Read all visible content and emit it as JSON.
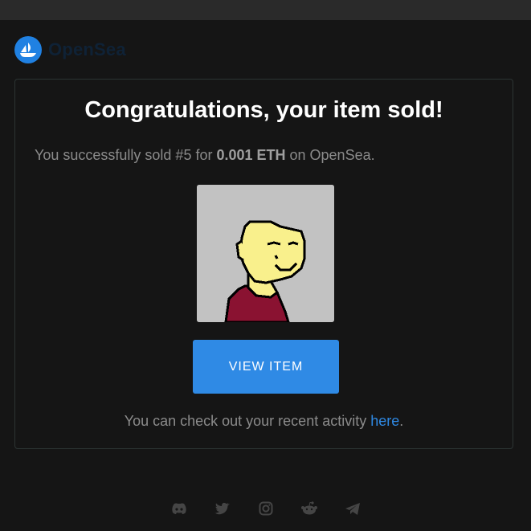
{
  "brand": {
    "name": "OpenSea"
  },
  "email": {
    "title": "Congratulations, your item sold!",
    "message_prefix": "You successfully sold #5 for ",
    "message_amount": "0.001 ETH",
    "message_suffix": " on OpenSea.",
    "view_item_label": "VIEW ITEM",
    "activity_prefix": "You can check out your recent activity ",
    "activity_link": "here",
    "activity_suffix": "."
  },
  "social_icons": [
    "discord-icon",
    "twitter-icon",
    "instagram-icon",
    "reddit-icon",
    "telegram-icon"
  ],
  "colors": {
    "accent": "#2f8ae5",
    "background": "#151515",
    "text_muted": "#8b8b8b",
    "nft_skin": "#f9f08c",
    "nft_shirt": "#8a1231"
  }
}
